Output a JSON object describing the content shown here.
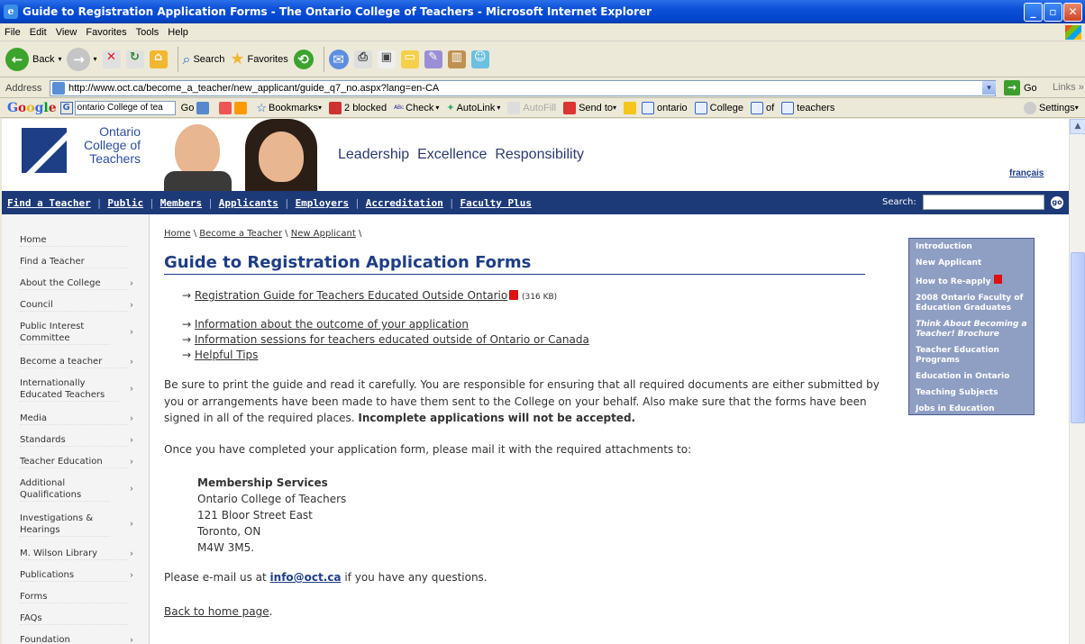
{
  "window": {
    "title": "Guide to Registration Application Forms - The Ontario College of Teachers - Microsoft Internet Explorer",
    "minimize": "_",
    "restore": "▫",
    "close": "✕"
  },
  "menu": [
    "File",
    "Edit",
    "View",
    "Favorites",
    "Tools",
    "Help"
  ],
  "toolbar": {
    "back": "Back",
    "search": "Search",
    "favorites": "Favorites"
  },
  "address": {
    "label": "Address",
    "url": "http://www.oct.ca/become_a_teacher/new_applicant/guide_q7_no.aspx?lang=en-CA",
    "go": "Go",
    "links": "Links"
  },
  "google": {
    "logo": "Google",
    "query": "ontario College of tea",
    "go": "Go",
    "bookmarks": "Bookmarks",
    "blocked": "2 blocked",
    "check": "Check",
    "autolink": "AutoLink",
    "autofill": "AutoFill",
    "sendto": "Send to",
    "terms": [
      "ontario",
      "College",
      "of",
      "teachers"
    ],
    "settings": "Settings"
  },
  "site": {
    "logo_lines": [
      "Ontario",
      "College of",
      "Teachers"
    ],
    "tagline": "Leadership  Excellence  Responsibility",
    "francais": "français",
    "nav": [
      "Find a Teacher",
      "Public",
      "Members",
      "Applicants",
      "Employers",
      "Accreditation",
      "Faculty Plus"
    ],
    "search_label": "Search:",
    "search_go": "go"
  },
  "leftnav": [
    {
      "label": "Home",
      "chev": false
    },
    {
      "label": "Find a Teacher",
      "chev": false
    },
    {
      "label": "About the College",
      "chev": true
    },
    {
      "label": "Council",
      "chev": true
    },
    {
      "label": "Public Interest Committee",
      "chev": true
    },
    {
      "label": "Become a teacher",
      "chev": true
    },
    {
      "label": "Internationally Educated Teachers",
      "chev": true
    },
    {
      "label": "Media",
      "chev": true
    },
    {
      "label": "Standards",
      "chev": true
    },
    {
      "label": "Teacher Education",
      "chev": true
    },
    {
      "label": "Additional Qualifications",
      "chev": true
    },
    {
      "label": "Investigations & Hearings",
      "chev": true
    },
    {
      "label": "M. Wilson Library",
      "chev": true
    },
    {
      "label": "Publications",
      "chev": true
    },
    {
      "label": "Forms",
      "chev": false
    },
    {
      "label": "FAQs",
      "chev": false
    },
    {
      "label": "Foundation",
      "chev": true
    }
  ],
  "breadcrumb": [
    "Home",
    "Become a Teacher",
    "New Applicant"
  ],
  "page_title": "Guide to Registration Application Forms",
  "links": {
    "guide": "Registration Guide for Teachers Educated Outside Ontario",
    "guide_size": "(316 KB)",
    "outcome": "Information about the outcome of your application",
    "sessions": "Information sessions for teachers educated outside of Ontario or Canada",
    "tips": "Helpful Tips"
  },
  "para1": "Be sure to print the guide and read it carefully. You are responsible for ensuring that all required documents are either submitted by you or arrangements have been made to have them sent to the College on your behalf. Also make sure that the forms have been signed in all of the required places. ",
  "para1_bold": "Incomplete applications will not be accepted.",
  "para2": "Once you have completed your application form, please mail it with the required attachments to:",
  "address_block": {
    "name": "Membership Services",
    "lines": [
      "Ontario College of Teachers",
      "121 Bloor Street East",
      "Toronto, ON",
      "M4W 3M5."
    ]
  },
  "email_pre": "Please e-mail us at ",
  "email": "info@oct.ca",
  "email_post": " if you have any questions.",
  "back_home": "Back to home page",
  "back_home_period": ".",
  "rightbox": [
    "Introduction",
    "New Applicant",
    "How to Re-apply",
    "2008 Ontario Faculty of Education Graduates",
    "Think About Becoming a Teacher! Brochure",
    "Teacher Education Programs",
    "Education in Ontario",
    "Teaching Subjects",
    "Jobs in Education"
  ]
}
